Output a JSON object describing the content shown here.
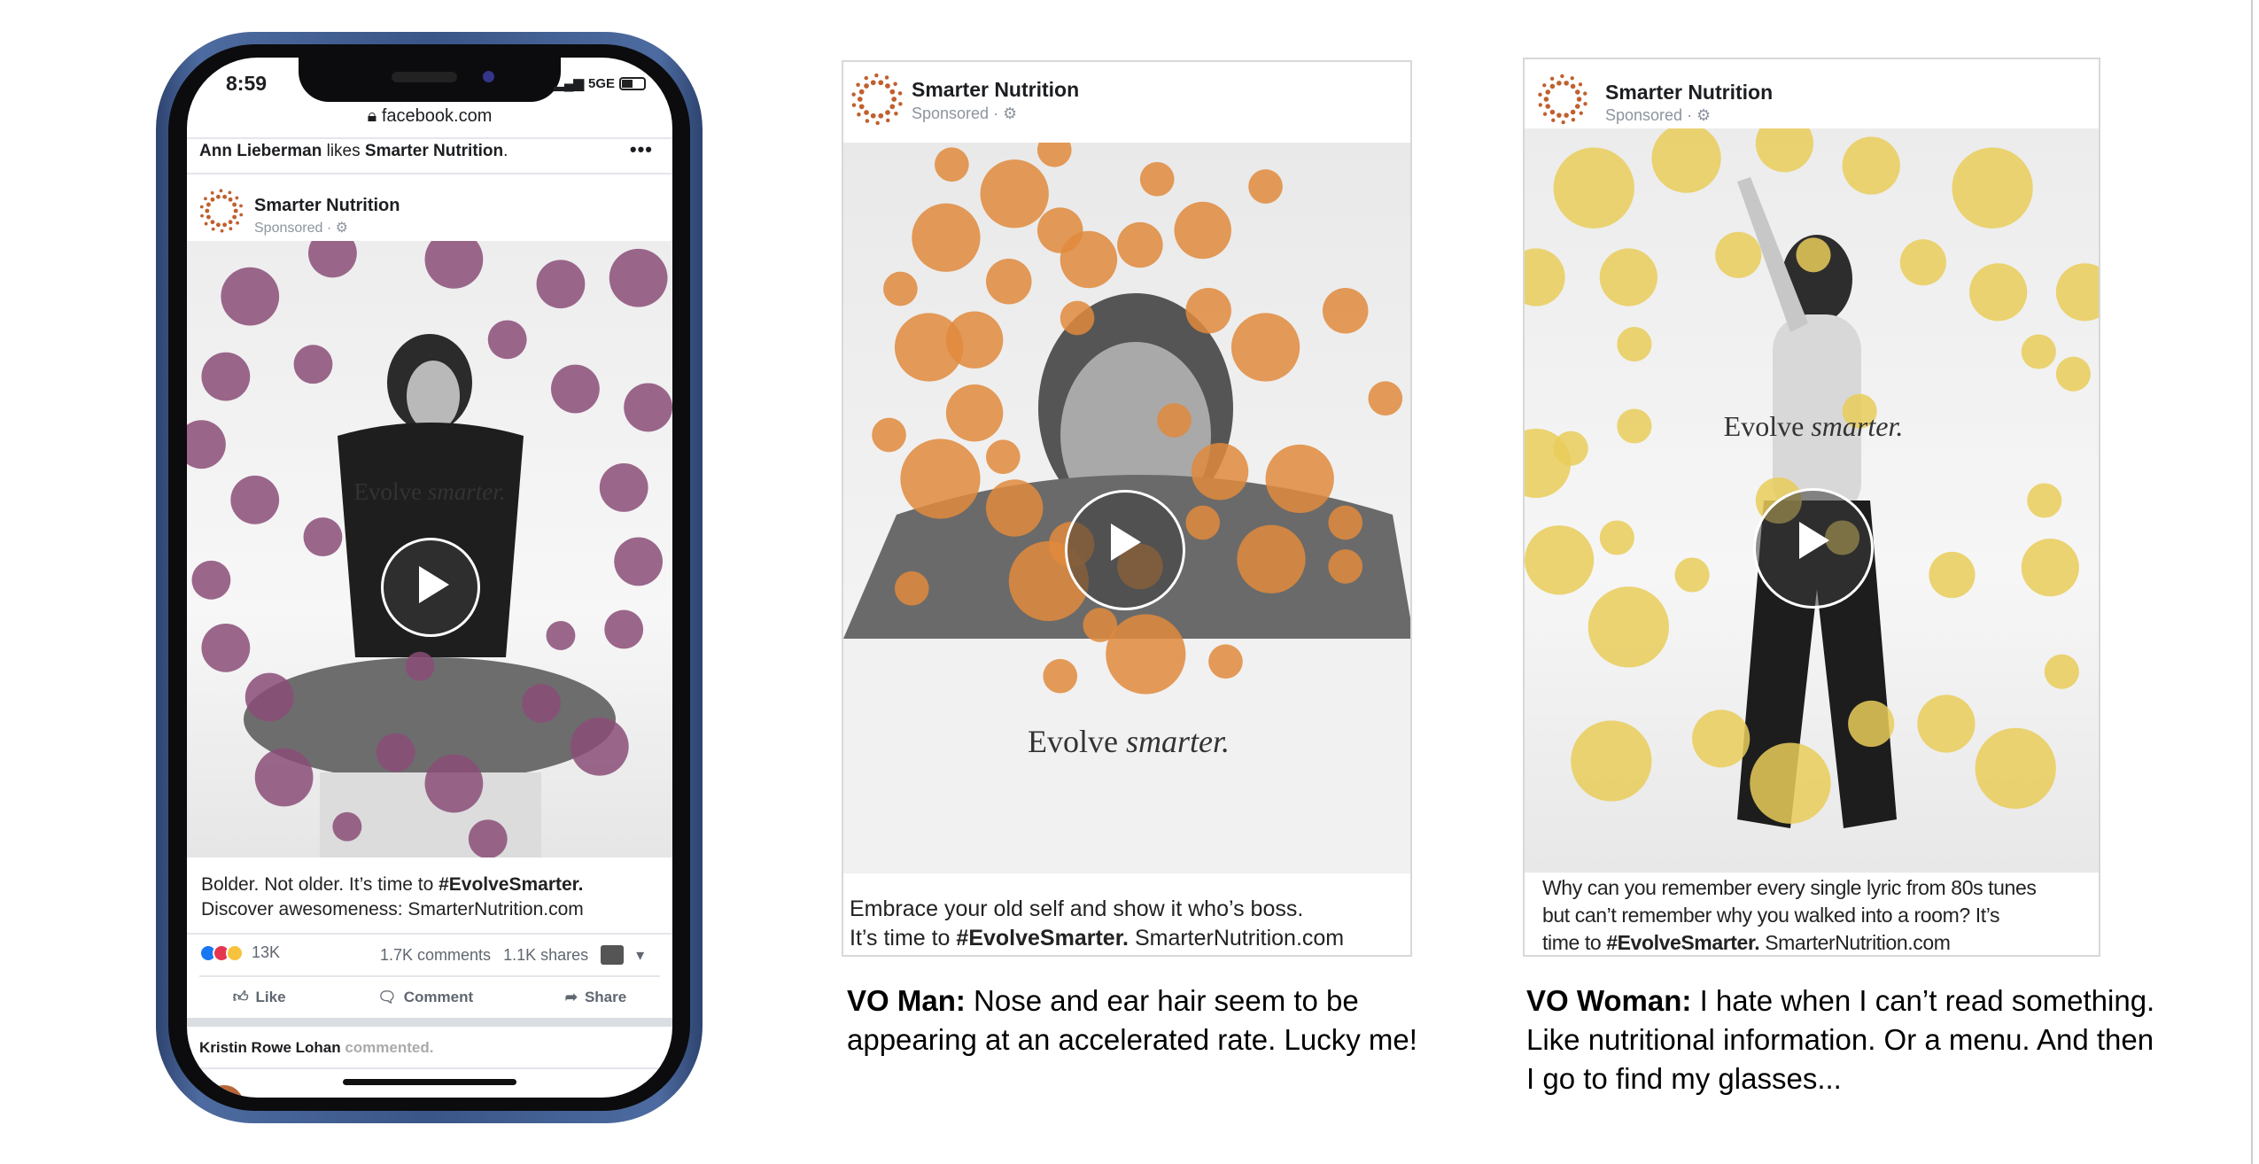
{
  "colors": {
    "phone_frame": "#3a5587",
    "purple_dots": "#8a4d78",
    "orange_dots": "#e08a3c",
    "yellow_dots": "#e9cd5a",
    "logo": "#c0602f"
  },
  "phone": {
    "status": {
      "time": "8:59",
      "network": "5GE",
      "signal_icon": "signal-icon",
      "battery_icon": "battery-icon"
    },
    "url": "facebook.com",
    "activity": {
      "actor": "Ann Lieberman",
      "verb": " likes ",
      "page": "Smarter Nutrition",
      "end": "."
    },
    "post": {
      "page_name": "Smarter Nutrition",
      "sponsored": "Sponsored · ⚙",
      "image_text": {
        "evolve": "Evolve ",
        "smarter": "smarter."
      },
      "caption_line1_a": "Bolder. Not older. It’s time to ",
      "caption_line1_b": "#EvolveSmarter.",
      "caption_line2": "Discover awesomeness:  SmarterNutrition.com",
      "reactions_count": "13K",
      "comments": "1.7K comments",
      "shares": "1.1K shares",
      "actions": {
        "like": "Like",
        "comment": "Comment",
        "share": "Share"
      }
    },
    "next_activity": {
      "actor": "Kristin Rowe Lohan",
      "verb": " commented."
    }
  },
  "ads": [
    {
      "page_name": "Smarter Nutrition",
      "sponsored": "Sponsored · ⚙",
      "image_text": {
        "evolve": "Evolve ",
        "smarter": "smarter."
      },
      "caption_lines": [
        "Embrace your old self and show it who’s boss."
      ],
      "caption_last_a": "It’s time to ",
      "caption_last_b": "#EvolveSmarter.",
      "caption_last_c": " SmarterNutrition.com",
      "vo_label": "VO Man:",
      "vo_text": "  Nose and ear hair seem to be appearing at an accelerated rate. Lucky me!"
    },
    {
      "page_name": "Smarter Nutrition",
      "sponsored": "Sponsored · ⚙",
      "image_text": {
        "evolve": "Evolve ",
        "smarter": "smarter."
      },
      "caption_lines": [
        "Why can you remember every single lyric from 80s tunes",
        "but can’t remember why you walked into a room?  It’s"
      ],
      "caption_last_a": "time to ",
      "caption_last_b": "#EvolveSmarter.",
      "caption_last_c": " SmarterNutrition.com",
      "vo_label": "VO Woman:",
      "vo_text": "  I hate when I can’t read something. Like nutritional information. Or a menu. And then I go to find my glasses..."
    }
  ]
}
